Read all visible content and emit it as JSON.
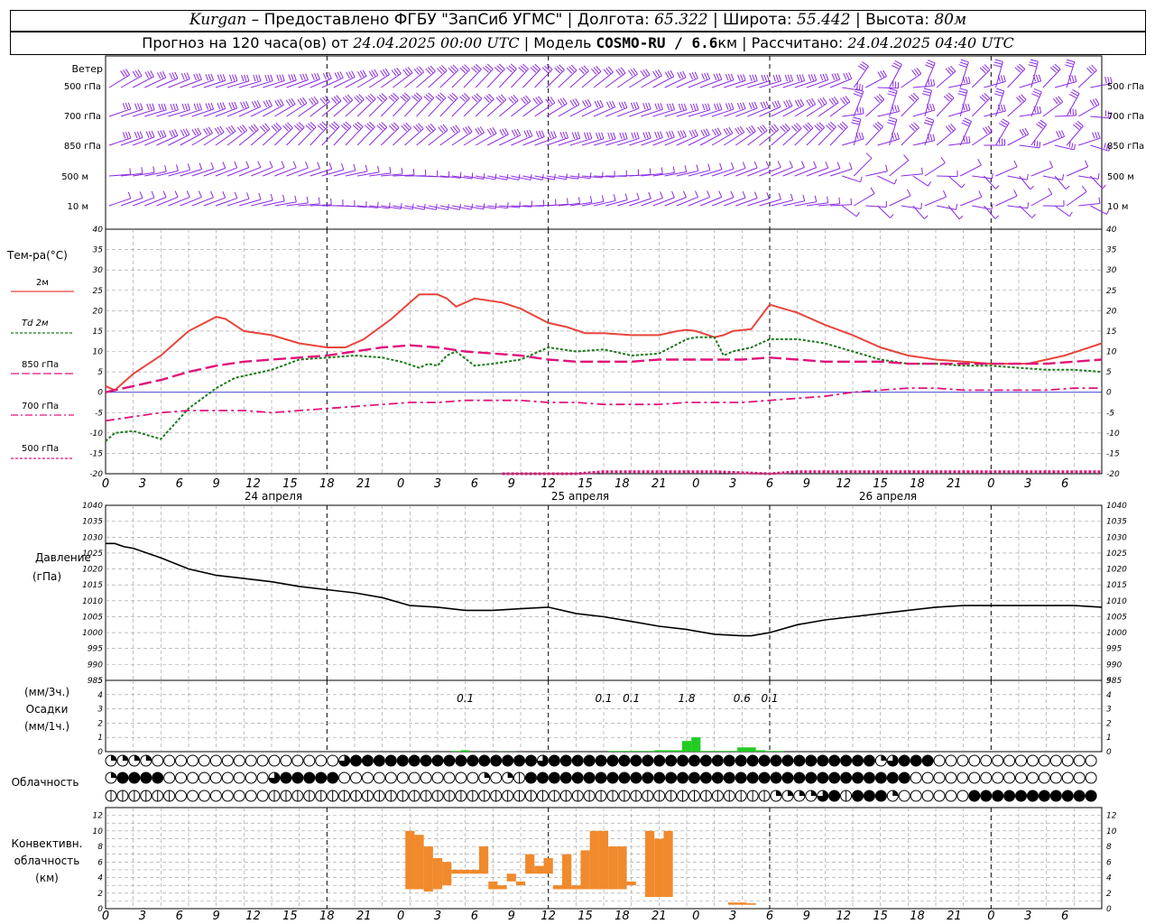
{
  "header": {
    "city": "Kurgan",
    "provider": "– Предоставлено ФГБУ \"ЗапСиб УГМС\"",
    "lon_label": "| Долгота:",
    "lon": "65.322",
    "lat_label": "| Широта:",
    "lat": "55.442",
    "alt_label": "| Высота:",
    "alt": "80м",
    "forecast_label": "Прогноз на 120 часа(ов) от",
    "forecast_start": "24.04.2025 00:00 UTC",
    "model_label": "| Модель",
    "model": "COSMO-RU / 6.6",
    "model_unit": "км",
    "calc_label": "| Рассчитано:",
    "calc_time": "24.04.2025 04:40 UTC"
  },
  "labels": {
    "wind": "Ветер",
    "wind_levels": [
      "500 гПа",
      "700 гПа",
      "850 гПа",
      "500 м",
      "10  м"
    ],
    "temp_title": "Тем-ра(°C)",
    "temp_legend": [
      "2м",
      "Td  2м",
      "850 гПа",
      "700 гПа",
      "500 гПа"
    ],
    "pressure_title": "Давление",
    "pressure_unit": "(гПа)",
    "precip_unit3": "(мм/3ч.)",
    "precip_title": "Осадки",
    "precip_unit1": "(мм/1ч.)",
    "cloud_title": "Облачность",
    "conv_title": [
      "Конвективн.",
      "облачность",
      "(км)"
    ]
  },
  "time_ticks": [
    "0",
    "3",
    "6",
    "9",
    "12",
    "15",
    "18",
    "21",
    "0",
    "3",
    "6",
    "9",
    "12",
    "15",
    "18",
    "21",
    "0",
    "3",
    "6",
    "9",
    "12",
    "15",
    "18",
    "21",
    "0",
    "3",
    "6"
  ],
  "dates": [
    "24 апреля",
    "25 апреля",
    "26 апреля"
  ],
  "precip_labels": [
    {
      "hour": 39,
      "text": "0.1"
    },
    {
      "hour": 54,
      "text": "0.1"
    },
    {
      "hour": 57,
      "text": "0.1"
    },
    {
      "hour": 63,
      "text": "1.8"
    },
    {
      "hour": 69,
      "text": "0.6"
    },
    {
      "hour": 72,
      "text": "0.1"
    }
  ],
  "colors": {
    "t2m": "#e8453c",
    "td2m": "#1a7a1a",
    "t850": "#e0147a",
    "t700": "#e0147a",
    "t500": "#e0147a",
    "wind": "#8a2be2",
    "pressure": "#000000",
    "precip": "#22cc22",
    "conv": "#f08a2c",
    "zero": "#3030d0"
  },
  "chart_data": [
    {
      "type": "line",
      "title": "Тем-ра(°C)",
      "x_unit": "hours from 24.04.2025 00:00 UTC",
      "ylim": [
        -20,
        40
      ],
      "series": [
        {
          "name": "2м",
          "x": [
            0,
            1,
            3,
            6,
            9,
            12,
            13,
            15,
            18,
            21,
            24,
            26,
            28,
            31,
            33,
            34,
            36,
            37,
            38,
            40,
            43,
            45,
            48,
            50,
            52,
            54,
            57,
            60,
            62,
            63,
            64,
            66,
            67,
            68,
            70,
            72,
            75,
            78,
            81,
            84,
            87,
            90,
            93,
            96,
            98,
            100,
            102,
            104,
            106,
            108
          ],
          "y": [
            1.5,
            0.5,
            4.5,
            9,
            15,
            18.5,
            18,
            15,
            14,
            12,
            11,
            11,
            13,
            18,
            22,
            24,
            24,
            23,
            21,
            23,
            22,
            20.5,
            17,
            16,
            14.5,
            14.5,
            14,
            14,
            15,
            15.3,
            15,
            13.5,
            14,
            15,
            15.5,
            21.5,
            19.5,
            16.5,
            14,
            11,
            9,
            8,
            7.5,
            7,
            7,
            7,
            8,
            9,
            10.5,
            12
          ]
        },
        {
          "name": "Td  2м",
          "x": [
            0,
            1,
            3,
            6,
            9,
            12,
            14,
            15,
            18,
            21,
            24,
            27,
            30,
            32,
            34,
            35,
            36,
            37,
            38,
            40,
            42,
            45,
            48,
            51,
            54,
            57,
            60,
            63,
            64,
            66,
            67,
            68,
            69,
            70,
            72,
            75,
            78,
            81,
            84,
            87,
            90,
            93,
            96,
            99,
            102,
            105,
            108
          ],
          "y": [
            -12,
            -10,
            -9.5,
            -11.5,
            -4,
            1,
            3.5,
            4,
            5.5,
            8,
            8.5,
            9,
            8.5,
            7.5,
            6,
            7,
            6.5,
            9,
            10,
            6.5,
            7,
            8,
            11,
            10,
            10.5,
            9,
            9.5,
            13,
            13.5,
            13.5,
            9,
            10,
            10.5,
            11,
            13,
            13,
            12,
            10,
            8,
            7,
            7,
            6.5,
            6.5,
            6,
            5.5,
            5.5,
            5
          ]
        },
        {
          "name": "850 гПа",
          "x": [
            0,
            3,
            6,
            9,
            12,
            15,
            18,
            21,
            24,
            27,
            30,
            33,
            36,
            39,
            42,
            45,
            48,
            51,
            54,
            57,
            60,
            63,
            66,
            69,
            72,
            75,
            78,
            81,
            84,
            87,
            90,
            93,
            96,
            99,
            102,
            105,
            108
          ],
          "y": [
            0,
            1.5,
            3,
            5,
            6.5,
            7.5,
            8,
            8.5,
            9,
            10,
            11,
            11.5,
            11,
            10,
            9.5,
            9,
            8,
            7.5,
            7.5,
            7.5,
            8,
            8,
            8,
            8,
            8.5,
            8,
            7.5,
            7.5,
            7.5,
            7,
            7,
            7,
            7,
            7,
            7,
            7.5,
            8
          ]
        },
        {
          "name": "700 гПа",
          "x": [
            0,
            3,
            6,
            9,
            12,
            15,
            18,
            21,
            24,
            27,
            30,
            33,
            36,
            39,
            42,
            45,
            48,
            51,
            54,
            57,
            60,
            63,
            66,
            69,
            72,
            75,
            78,
            81,
            84,
            87,
            90,
            93,
            96,
            99,
            102,
            105,
            108
          ],
          "y": [
            -7,
            -6,
            -5,
            -4.5,
            -4.5,
            -4.5,
            -5,
            -4.5,
            -4,
            -3.5,
            -3,
            -2.5,
            -2.5,
            -2,
            -2,
            -2,
            -2.5,
            -2.5,
            -3,
            -3,
            -3,
            -2.5,
            -2.5,
            -2.5,
            -2,
            -1.5,
            -1,
            0,
            0.5,
            1,
            1,
            0.5,
            0.5,
            0.5,
            0.5,
            1,
            1
          ]
        },
        {
          "name": "500 гПа",
          "x": [
            43,
            45,
            48,
            51,
            54,
            57,
            60,
            63,
            66,
            72,
            75,
            78,
            81,
            84,
            87,
            90,
            93,
            96,
            99,
            102,
            105,
            108
          ],
          "y": [
            -20,
            -20,
            -20,
            -20,
            -19.5,
            -19.5,
            -19.5,
            -19.5,
            -19.5,
            -20,
            -19.5,
            -19.5,
            -19.5,
            -19.5,
            -19.5,
            -19.5,
            -19.5,
            -19.5,
            -19.5,
            -19.5,
            -19.5,
            -19.5
          ]
        }
      ]
    },
    {
      "type": "line",
      "title": "Давление",
      "ylabel": "(гПа)",
      "ylim": [
        985,
        1040
      ],
      "series": [
        {
          "name": "Давление",
          "x": [
            0,
            1,
            2,
            3,
            6,
            9,
            12,
            15,
            18,
            21,
            24,
            27,
            30,
            33,
            36,
            39,
            42,
            45,
            48,
            51,
            54,
            57,
            60,
            63,
            66,
            69,
            70,
            72,
            75,
            78,
            81,
            84,
            87,
            90,
            93,
            96,
            99,
            102,
            105,
            108
          ],
          "y": [
            1028,
            1028,
            1027,
            1026.5,
            1023.5,
            1020,
            1018,
            1017,
            1016,
            1014.5,
            1013.5,
            1012.5,
            1011,
            1008.5,
            1008,
            1007,
            1007,
            1007.5,
            1008,
            1006,
            1005,
            1003.5,
            1002,
            1001,
            999.5,
            999,
            999,
            1000,
            1002.5,
            1004,
            1005,
            1006,
            1007,
            1008,
            1008.5,
            1008.5,
            1008.5,
            1008.5,
            1008.5,
            1008
          ]
        }
      ]
    },
    {
      "type": "bar",
      "title": "Осадки",
      "ylabel": "(мм/1ч.)",
      "ylim": [
        0,
        5
      ],
      "x": [
        38,
        39,
        43,
        44,
        55,
        56,
        57,
        58,
        59,
        60,
        61,
        62,
        63,
        64,
        65,
        66,
        67,
        68,
        69,
        70,
        71,
        72,
        73
      ],
      "values": [
        0.05,
        0.1,
        0.01,
        0.01,
        0.05,
        0.05,
        0.05,
        0.05,
        0.05,
        0.1,
        0.1,
        0.1,
        0.75,
        1.0,
        0.05,
        0.05,
        0.05,
        0.05,
        0.3,
        0.3,
        0.1,
        0.05,
        0.05
      ]
    },
    {
      "type": "bar",
      "title": "Конвективн. облачность",
      "ylabel": "(км)",
      "ylim": [
        0,
        13
      ],
      "segments": [
        {
          "x": 33,
          "base": 2.5,
          "top": 10
        },
        {
          "x": 34,
          "base": 2.5,
          "top": 9.5
        },
        {
          "x": 35,
          "base": 2.2,
          "top": 8
        },
        {
          "x": 36,
          "base": 2.5,
          "top": 6.5
        },
        {
          "x": 37,
          "base": 3,
          "top": 6
        },
        {
          "x": 38,
          "base": 4.5,
          "top": 5
        },
        {
          "x": 39,
          "base": 4.5,
          "top": 5
        },
        {
          "x": 40,
          "base": 4.5,
          "top": 5
        },
        {
          "x": 41,
          "base": 4.5,
          "top": 8
        },
        {
          "x": 42,
          "base": 2.5,
          "top": 3.5
        },
        {
          "x": 43,
          "base": 2.5,
          "top": 3
        },
        {
          "x": 44,
          "base": 3.5,
          "top": 4.5
        },
        {
          "x": 45,
          "base": 3,
          "top": 3.5
        },
        {
          "x": 46,
          "base": 4.5,
          "top": 7
        },
        {
          "x": 47,
          "base": 4.5,
          "top": 5.5
        },
        {
          "x": 48,
          "base": 4.5,
          "top": 6.5
        },
        {
          "x": 49,
          "base": 2.5,
          "top": 3
        },
        {
          "x": 50,
          "base": 2.5,
          "top": 7
        },
        {
          "x": 51,
          "base": 2.5,
          "top": 3
        },
        {
          "x": 52,
          "base": 2.5,
          "top": 7.5
        },
        {
          "x": 53,
          "base": 2.5,
          "top": 10
        },
        {
          "x": 54,
          "base": 2.5,
          "top": 10
        },
        {
          "x": 55,
          "base": 2.5,
          "top": 8
        },
        {
          "x": 56,
          "base": 2.5,
          "top": 8
        },
        {
          "x": 57,
          "base": 3,
          "top": 3.5
        },
        {
          "x": 59,
          "base": 1.5,
          "top": 10
        },
        {
          "x": 60,
          "base": 1.5,
          "top": 9
        },
        {
          "x": 61,
          "base": 1.5,
          "top": 10
        },
        {
          "x": 68,
          "base": 0.5,
          "top": 0.8
        },
        {
          "x": 69,
          "base": 0.5,
          "top": 0.8
        },
        {
          "x": 70,
          "base": 0.5,
          "top": 0.7
        }
      ]
    }
  ],
  "clouds": {
    "rows": [
      "EEEEOOOOOOOOOOOOOOOOPFFFFFFFFFFFFFFFFPFFFFFFFFFFFFFFFFFFFFFFFFFFFFEPFFFOOOOOOOOOOOOOOOOO",
      "EFFFFOOOOOOOOOPFFFFFOOOOOOOOOOOOEOEHFFFFFFFFFFFFFFFFFFFFFFFFFFFFFFFFFOOOOOOOOOOOOOOOOOO",
      "HHHHHHOOOOOOOOHHHHHHHHHHHHHHHHHHHHHHHHHHHHHHHHHHHHHHHHHHHEEEEPFHFFFEOOOOOOFFFFFFFFFFFFF"
    ]
  }
}
